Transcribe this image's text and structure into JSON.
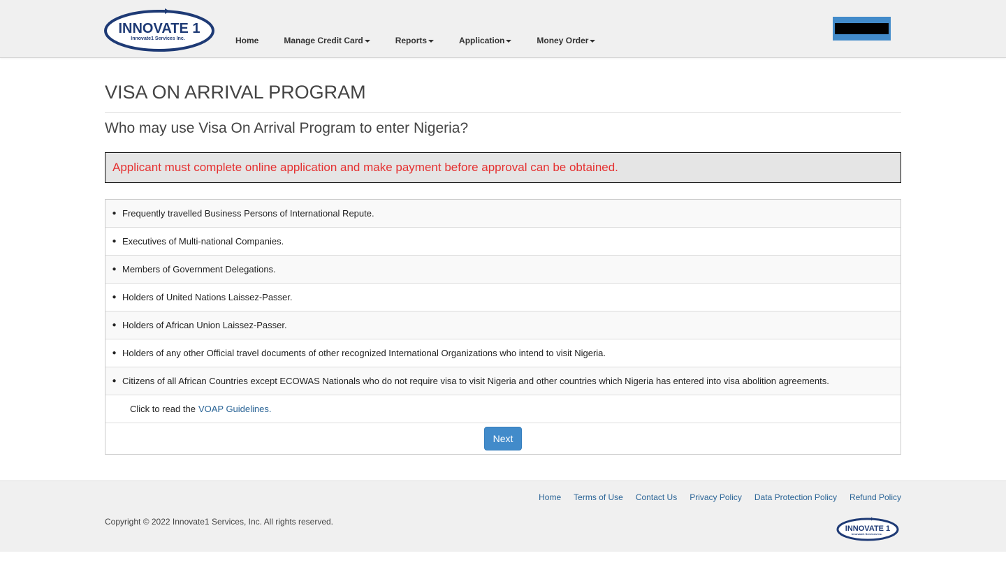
{
  "header": {
    "logo": {
      "main_text": "INNOVATE 1",
      "sub_text": "Innovate1 Services Inc."
    },
    "nav": [
      {
        "label": "Home",
        "dropdown": false
      },
      {
        "label": "Manage Credit Card",
        "dropdown": true
      },
      {
        "label": "Reports",
        "dropdown": true
      },
      {
        "label": "Application",
        "dropdown": true
      },
      {
        "label": "Money Order",
        "dropdown": true
      }
    ]
  },
  "main": {
    "title": "VISA ON ARRIVAL PROGRAM",
    "subtitle": "Who may use Visa On Arrival Program to enter Nigeria?",
    "alert": "Applicant must complete online application and make payment before approval can be obtained.",
    "eligibility": [
      "Frequently travelled Business Persons of International Repute.",
      "Executives of Multi-national Companies.",
      "Members of Government Delegations.",
      "Holders of United Nations Laissez-Passer.",
      "Holders of African Union Laissez-Passer.",
      "Holders of any other Official travel documents of other recognized International Organizations who intend to visit Nigeria.",
      "Citizens of all African Countries except ECOWAS Nationals who do not require visa to visit Nigeria and other countries which Nigeria has entered into visa abolition agreements."
    ],
    "guidelines_prefix": "Click to read the",
    "guidelines_link": "VOAP Guidelines.",
    "next_label": "Next"
  },
  "footer": {
    "links": [
      "Home",
      "Terms of Use",
      "Contact Us",
      "Privacy Policy",
      "Data Protection Policy",
      "Refund Policy"
    ],
    "copyright": "Copyright © 2022 Innovate1 Services, Inc. All rights reserved.",
    "logo": {
      "main_text": "INNOVATE 1",
      "sub_text": "Innovate1 Services Inc."
    }
  },
  "colors": {
    "brand_navy": "#1e3a75",
    "primary_blue": "#428bca",
    "link_blue": "#2a6496",
    "alert_red": "#e53030"
  }
}
